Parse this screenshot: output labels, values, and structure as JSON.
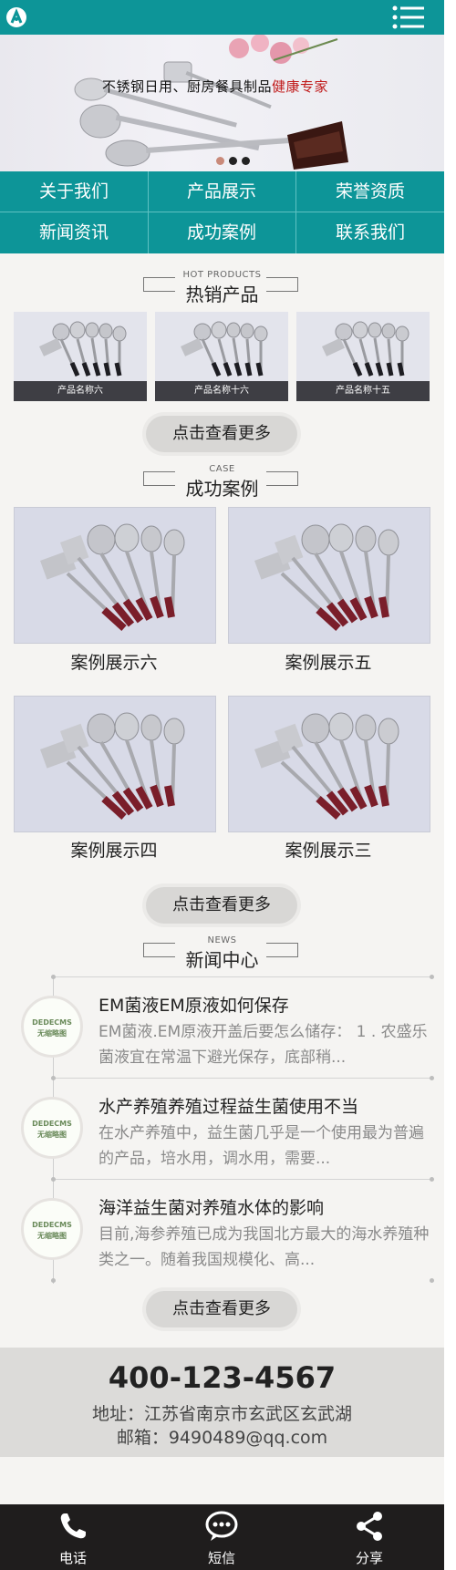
{
  "header": {
    "logo_icon": "circle-a-logo-icon",
    "menu_icon": "list-menu-icon"
  },
  "banner": {
    "headline_black": "不锈钢日用、厨房餐具制品",
    "headline_red": "健康专家",
    "slides": 3,
    "active_slide": 1
  },
  "nav": {
    "items": [
      {
        "label": "关于我们"
      },
      {
        "label": "产品展示"
      },
      {
        "label": "荣誉资质"
      },
      {
        "label": "新闻资讯"
      },
      {
        "label": "成功案例"
      },
      {
        "label": "联系我们"
      }
    ]
  },
  "hot_products": {
    "title_en": "HOT PRODUCTS",
    "title_cn": "热销产品",
    "items": [
      {
        "label": "产品名称六"
      },
      {
        "label": "产品名称十六"
      },
      {
        "label": "产品名称十五"
      }
    ],
    "more_label": "点击查看更多"
  },
  "cases": {
    "title_en": "CASE",
    "title_cn": "成功案例",
    "items": [
      {
        "label": "案例展示六"
      },
      {
        "label": "案例展示五"
      },
      {
        "label": "案例展示四"
      },
      {
        "label": "案例展示三"
      }
    ],
    "more_label": "点击查看更多"
  },
  "news": {
    "title_en": "NEWS",
    "title_cn": "新闻中心",
    "thumb_line1": "DEDECMS",
    "thumb_line2": "无缩略图",
    "items": [
      {
        "title": "EM菌液EM原液如何保存",
        "summary": "EM菌液.EM原液开盖后要怎么储存： 1 . 农盛乐菌液宜在常温下避光保存，底部稍..."
      },
      {
        "title": "水产养殖养殖过程益生菌使用不当",
        "summary": "在水产养殖中，益生菌几乎是一个使用最为普遍的产品，培水用，调水用，需要..."
      },
      {
        "title": "海洋益生菌对养殖水体的影响",
        "summary": "目前,海参养殖已成为我国北方最大的海水养殖种类之一。随着我国规模化、高..."
      }
    ],
    "more_label": "点击查看更多"
  },
  "contact": {
    "phone": "400-123-4567",
    "address": "地址：江苏省南京市玄武区玄武湖",
    "email": "邮箱：9490489@qq.com"
  },
  "bottom_bar": {
    "items": [
      {
        "label": "电话",
        "icon": "phone-icon"
      },
      {
        "label": "短信",
        "icon": "message-icon"
      },
      {
        "label": "分享",
        "icon": "share-icon"
      }
    ]
  },
  "colors": {
    "brand": "#0d9598",
    "footer_bar": "#1f1d1d",
    "accent_red": "#c01818"
  }
}
